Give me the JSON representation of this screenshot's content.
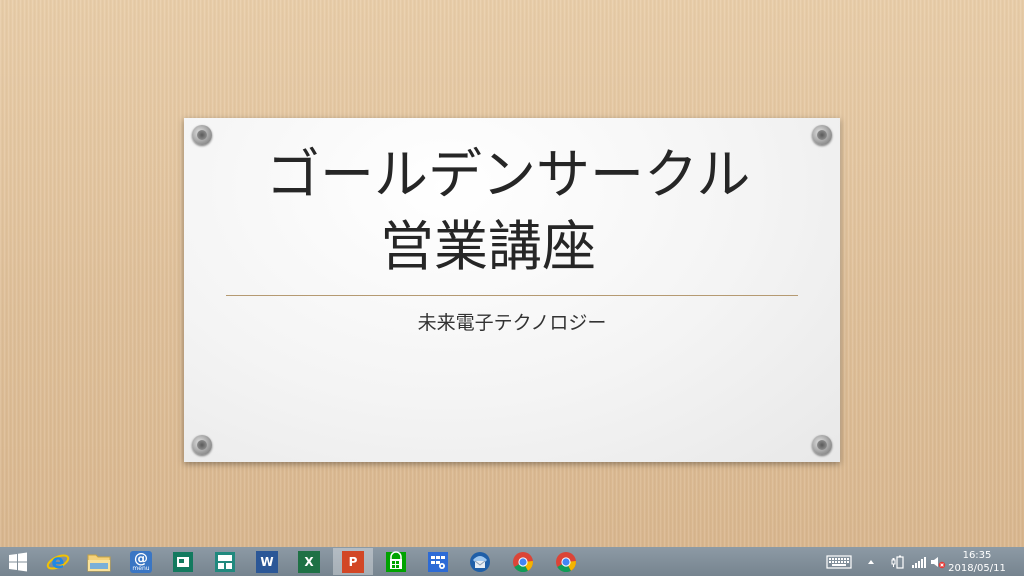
{
  "slide": {
    "title_line1": "ゴールデンサークル",
    "title_line2": "営業講座",
    "subtitle": "未来電子テクノロジー"
  },
  "taskbar": {
    "apps": [
      {
        "name": "start-button",
        "icon": "windows-logo-icon"
      },
      {
        "name": "internet-explorer",
        "icon": "internet-explorer-icon"
      },
      {
        "name": "file-explorer",
        "icon": "folder-icon"
      },
      {
        "name": "mail-menu",
        "icon": "at-mail-icon",
        "label": "menu"
      },
      {
        "name": "publisher",
        "icon": "publisher-icon"
      },
      {
        "name": "tiles-app",
        "icon": "tiles-icon"
      },
      {
        "name": "word",
        "icon": "word-icon",
        "label": "W"
      },
      {
        "name": "excel",
        "icon": "excel-icon",
        "label": "X"
      },
      {
        "name": "powerpoint",
        "icon": "powerpoint-icon",
        "label": "P",
        "active": true
      },
      {
        "name": "store",
        "icon": "store-icon"
      },
      {
        "name": "control-panel",
        "icon": "control-panel-icon"
      },
      {
        "name": "thunderbird",
        "icon": "thunderbird-icon"
      },
      {
        "name": "chrome",
        "icon": "chrome-icon"
      },
      {
        "name": "chrome-alt",
        "icon": "chrome-icon"
      }
    ],
    "clock": {
      "time": "16:35",
      "date": "2018/05/11"
    },
    "tray_icons": [
      "keyboard-icon",
      "show-hidden-icons-arrow",
      "battery-plug-icon",
      "signal-bars-icon",
      "volume-muted-icon"
    ],
    "colors": {
      "taskbar": "#7e8c98",
      "desk": "#e2c39e",
      "divider": "#b59a72"
    }
  }
}
